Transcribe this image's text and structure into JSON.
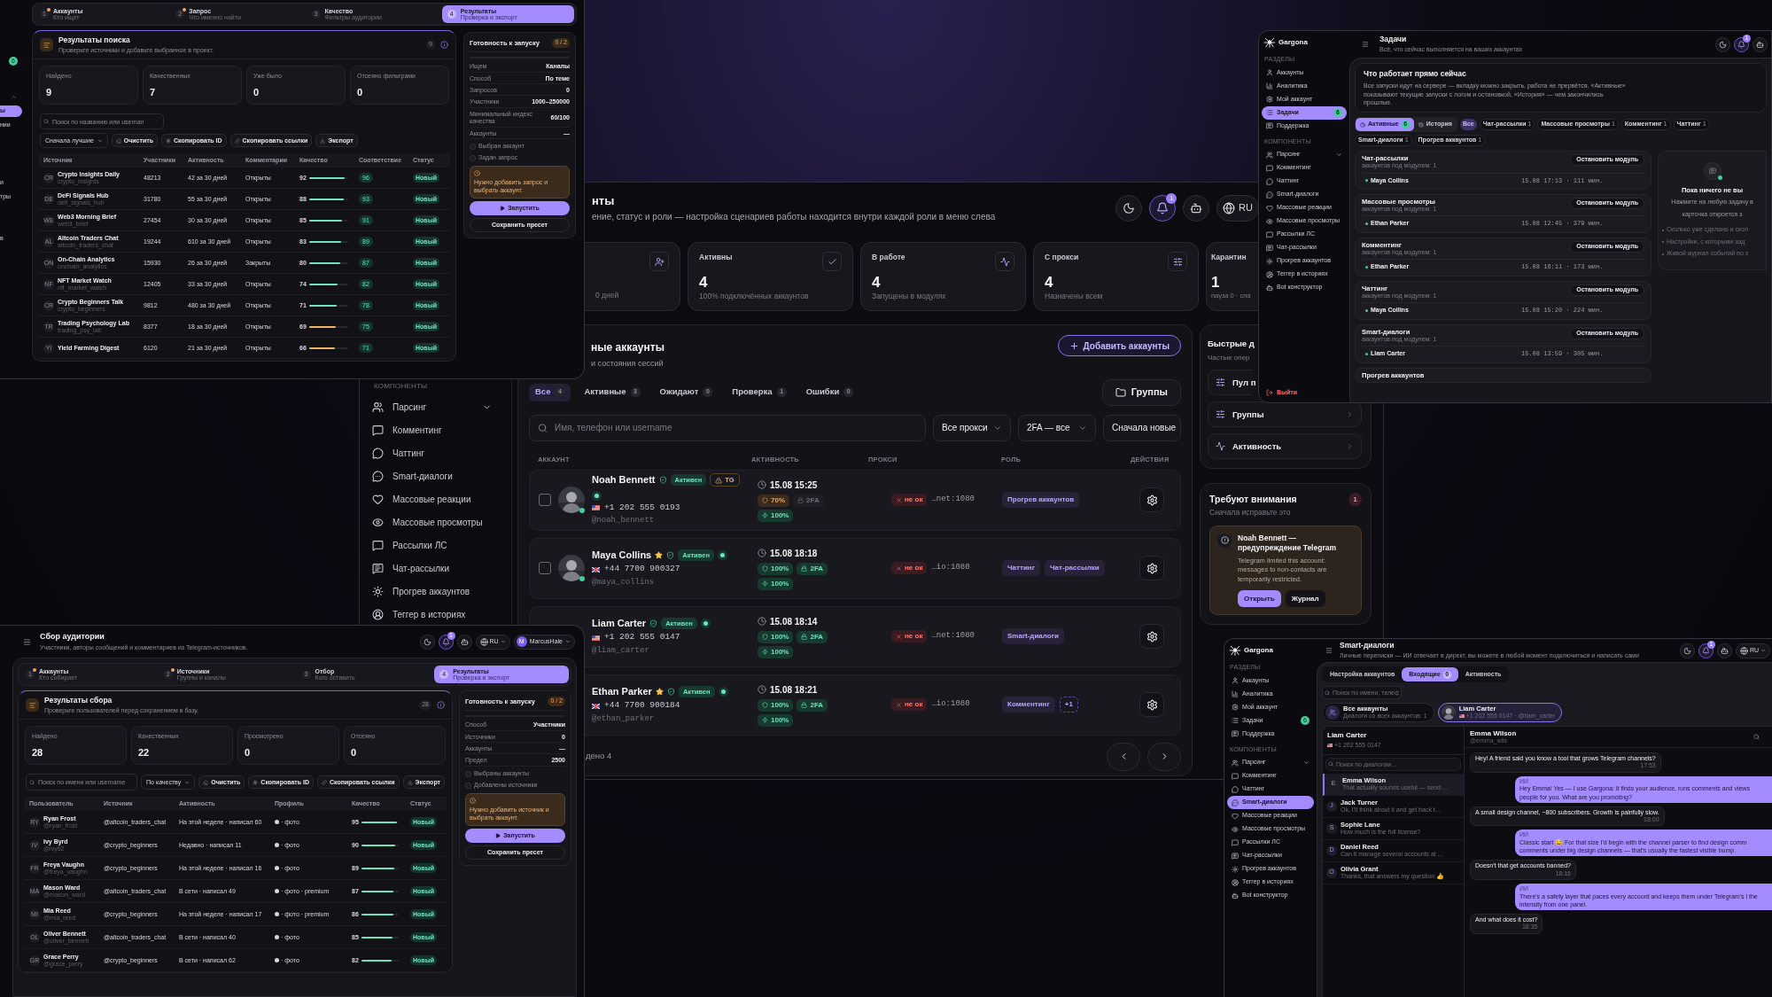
{
  "accounts_window": {
    "sidebar": {
      "sections": [
        {
          "title": "КОМПОНЕНТЫ",
          "items": [
            {
              "label": "Парсинг",
              "selected": false,
              "expanded": false
            },
            {
              "label": "Комментинг",
              "selected": false
            },
            {
              "label": "Чаттинг",
              "selected": false
            },
            {
              "label": "Smart-диалоги",
              "selected": false
            },
            {
              "label": "Массовые реакции",
              "selected": false
            },
            {
              "label": "Массовые просмотры",
              "selected": false
            },
            {
              "label": "Рассылки ЛС",
              "selected": false
            },
            {
              "label": "Чат-рассылки",
              "selected": false
            },
            {
              "label": "Прогрев аккаунтов",
              "selected": false
            },
            {
              "label": "Теггер в историях",
              "selected": false
            }
          ]
        }
      ]
    },
    "header": {
      "title": "нты",
      "subtitle": "ение, статус и роли — настройка сценариев работы находится внутри каждой роли в меню слева",
      "notifications": "1",
      "language": "RU"
    },
    "stats": [
      {
        "note": "0 дней"
      },
      {
        "label": "Активны",
        "value": "4",
        "note": "100% подключённых аккаунтов"
      },
      {
        "label": "В работе",
        "value": "4",
        "note": "Запущены в модулях"
      },
      {
        "label": "С прокси",
        "value": "4",
        "note": "Назначены всем"
      },
      {
        "label": "Карантин",
        "value": "1",
        "note": "пауза 0 · спа"
      }
    ],
    "panel": {
      "title": "ные аккаунты",
      "subtitle": "и состояния сессий",
      "add_button": "Добавить аккаунты",
      "groups_button": "Группы",
      "tabs": [
        {
          "label": "Все",
          "count": "4",
          "selected": true
        },
        {
          "label": "Активные",
          "count": "3",
          "selected": false
        },
        {
          "label": "Ожидают",
          "count": "0",
          "selected": false
        },
        {
          "label": "Проверка",
          "count": "1",
          "selected": false
        },
        {
          "label": "Ошибки",
          "count": "0",
          "selected": false
        }
      ],
      "search": {
        "placeholder": "Имя, телефон или username"
      },
      "filters": [
        "Все прокси",
        "2FA — все",
        "Сначала новые"
      ],
      "columns": [
        "АККАУНТ",
        "АКТИВНОСТЬ",
        "ПРОКСИ",
        "РОЛЬ",
        "ДЕЙСТВИЯ"
      ],
      "rows": [
        {
          "selected": false,
          "avatar": {
            "kind": "picture",
            "online": true
          },
          "name": "Noah Bennett",
          "starred": false,
          "status": "Активен",
          "warning": "TG",
          "flag": {
            "kind": "us"
          },
          "phone": "+1 202 555 0193",
          "username": "@noah_bennett",
          "last_active": "15.08 15:25",
          "trust": "70%",
          "trust_ok": false,
          "twofa": "2FA",
          "twofa_on": false,
          "energy": "100%",
          "proxy_status": "не ок",
          "proxy": "…net:1080",
          "roles": [
            {
              "label": "Прогрев аккаунтов",
              "kind": "role"
            }
          ]
        },
        {
          "selected": false,
          "avatar": {
            "kind": "picture",
            "online": true
          },
          "name": "Maya Collins",
          "starred": true,
          "status": "Активен",
          "flag": {
            "kind": "gb"
          },
          "phone": "+44 7700 900327",
          "username": "@maya_collins",
          "last_active": "15.08 18:18",
          "trust": "100%",
          "trust_ok": true,
          "twofa": "2FA",
          "twofa_on": true,
          "energy": "100%",
          "proxy_status": "не ок",
          "proxy": "…io:1080",
          "roles": [
            {
              "label": "Чаттинг",
              "kind": "role"
            },
            {
              "label": "Чат-рассылки",
              "kind": "role"
            }
          ]
        },
        {
          "name": "Liam Carter",
          "starred": false,
          "status": "Активен",
          "flag": {
            "kind": "us"
          },
          "phone": "+1 202 555 0147",
          "username": "@liam_carter",
          "last_active": "15.08 18:14",
          "trust": "100%",
          "trust_ok": true,
          "twofa": "2FA",
          "twofa_on": true,
          "energy": "100%",
          "proxy_status": "не ок",
          "proxy": "…net:1080",
          "roles": [
            {
              "label": "Smart-диалоги",
              "kind": "role"
            }
          ]
        },
        {
          "name": "Ethan Parker",
          "starred": true,
          "status": "Активен",
          "flag": {
            "kind": "gb"
          },
          "phone": "+44 7700 900184",
          "username": "@ethan_parker",
          "last_active": "15.08 18:21",
          "trust": "100%",
          "trust_ok": true,
          "twofa": "2FA",
          "twofa_on": true,
          "energy": "100%",
          "proxy_status": "не ок",
          "proxy": "…io:1080",
          "roles": [
            {
              "label": "Комментинг",
              "kind": "role"
            },
            {
              "label": "+1",
              "kind": "more"
            }
          ]
        }
      ],
      "footer": "дено 4"
    },
    "quick": {
      "title": "Быстрые д",
      "subtitle": "Частые опер",
      "items": [
        {
          "label": "Пул п",
          "chevron": false
        },
        {
          "label": "Группы",
          "chevron": true
        },
        {
          "label": "Активность",
          "chevron": true
        }
      ]
    },
    "attention": {
      "title": "Требуют внимания",
      "subtitle": "Сначала исправьте это",
      "count": "1",
      "alert": {
        "title": "Noah Bennett — предупреждение Telegram",
        "text": "Telegram limited this account: messages to non-contacts are temporarily restricted.",
        "buttons": [
          "Открыть",
          "Журнал"
        ]
      }
    }
  },
  "search_window": {
    "sidebar": {
      "badge": "6",
      "items": [
        {
          "label": "ы",
          "selected": true
        },
        {
          "label": "нии",
          "selected": false
        },
        {
          "label": "и",
          "selected": false
        },
        {
          "label": "тры",
          "selected": false
        },
        {
          "label": "в",
          "selected": false
        }
      ]
    },
    "steps": [
      {
        "number": "1",
        "title": "Аккаунты",
        "subtitle": "Кто ищет",
        "pending": true,
        "selected": false
      },
      {
        "number": "2",
        "title": "Запрос",
        "subtitle": "Что именно найти",
        "pending": true,
        "selected": false
      },
      {
        "number": "3",
        "title": "Качество",
        "subtitle": "Фильтры аудитории",
        "pending": false,
        "selected": false
      },
      {
        "number": "4",
        "title": "Результаты",
        "subtitle": "Проверка и экспорт",
        "pending": false,
        "selected": true
      }
    ],
    "results": {
      "title": "Результаты поиска",
      "subtitle": "Проверьте источники и добавьте выбранное в проект.",
      "count": "9",
      "stats": [
        {
          "label": "Найдено",
          "value": "9"
        },
        {
          "label": "Качественных",
          "value": "7"
        },
        {
          "label": "Уже было",
          "value": "0"
        },
        {
          "label": "Отсеяно фильтрами",
          "value": "0"
        }
      ],
      "search": {
        "placeholder": "Поиск по названию или usernan"
      },
      "sort": "Сначала лучшие",
      "actions": [
        "Очистить",
        "Скопировать ID",
        "Скопировать ссылки",
        "Экспорт"
      ],
      "columns": [
        "Источник",
        "Участники",
        "Активность",
        "Комментарии",
        "Качество",
        "Соответствие",
        "Статус"
      ],
      "rows": [
        {
          "initials": "CR",
          "name": "Crypto Insights Daily",
          "handle": "crypto_insights",
          "members": "48213",
          "activity": "42 за 30 дней",
          "comments": "Открыты",
          "quality": "92",
          "level": 0.92,
          "color": "#6be3c4",
          "match": "96",
          "status": "Новый"
        },
        {
          "initials": "DE",
          "name": "DeFi Signals Hub",
          "handle": "defi_signals_hub",
          "members": "31780",
          "activity": "55 за 30 дней",
          "comments": "Открыты",
          "quality": "88",
          "level": 0.88,
          "color": "#6be3c4",
          "match": "93",
          "status": "Новый"
        },
        {
          "initials": "WE",
          "name": "Web3 Morning Brief",
          "handle": "web3_brief",
          "members": "27454",
          "activity": "30 за 30 дней",
          "comments": "Открыты",
          "quality": "85",
          "level": 0.85,
          "color": "#6be3c4",
          "match": "91",
          "status": "Новый"
        },
        {
          "initials": "AL",
          "name": "Altcoin Traders Chat",
          "handle": "altcoin_traders_chat",
          "members": "19244",
          "activity": "610 за 30 дней",
          "comments": "Открыты",
          "quality": "83",
          "level": 0.83,
          "color": "#6be3c4",
          "match": "89",
          "status": "Новый"
        },
        {
          "initials": "ON",
          "name": "On-Chain Analytics",
          "handle": "onchain_analytics",
          "members": "15930",
          "activity": "26 за 30 дней",
          "comments": "Закрыты",
          "quality": "80",
          "level": 0.8,
          "color": "#6be3c4",
          "match": "87",
          "status": "Новый"
        },
        {
          "initials": "NF",
          "name": "NFT Market Watch",
          "handle": "nft_market_watch",
          "members": "12405",
          "activity": "33 за 30 дней",
          "comments": "Открыты",
          "quality": "74",
          "level": 0.74,
          "color": "#6be3c4",
          "match": "82",
          "status": "Новый"
        },
        {
          "initials": "CR",
          "name": "Crypto Beginners Talk",
          "handle": "crypto_beginners",
          "members": "9812",
          "activity": "480 за 30 дней",
          "comments": "Открыты",
          "quality": "71",
          "level": 0.71,
          "color": "#6be3c4",
          "match": "78",
          "status": "Новый"
        },
        {
          "initials": "TR",
          "name": "Trading Psychology Lab",
          "handle": "trading_psy_lab",
          "members": "8377",
          "activity": "18 за 30 дней",
          "comments": "Открыты",
          "quality": "69",
          "level": 0.69,
          "color": "#f2b264",
          "match": "75",
          "status": "Новый"
        },
        {
          "initials": "YI",
          "name": "Yield Farming Digest",
          "members": "6120",
          "activity": "21 за 30 дней",
          "comments": "Открыты",
          "quality": "66",
          "level": 0.66,
          "color": "#f2b264",
          "match": "71",
          "status": "Новый"
        }
      ]
    },
    "readiness": {
      "title": "Готовность к запуску",
      "badge": "0 / 2",
      "rows": [
        {
          "label": "Ищем",
          "value": "Каналы"
        },
        {
          "label": "Способ",
          "value": "По теме"
        },
        {
          "label": "Запросов",
          "value": "0"
        },
        {
          "label": "Участники",
          "value": "1000–250000"
        },
        {
          "label": "Минимальный индекс качества",
          "value": "60/100"
        },
        {
          "label": "Аккаунты",
          "value": "—"
        }
      ],
      "checks": [
        {
          "label": "Выбран аккаунт",
          "checked": false
        },
        {
          "label": "Задан запрос",
          "checked": false
        }
      ],
      "warning": "Нужно добавить запрос и выбрать аккаунт.",
      "run": "Запустить",
      "save": "Сохранить пресет"
    }
  },
  "audience_window": {
    "header": {
      "title": "Сбор аудитории",
      "subtitle": "Участники, авторы сообщений и комментариев из Telegram-источников.",
      "notifications": "1",
      "language": "RU",
      "user_initial": "M",
      "user": "MarcusHale"
    },
    "steps": [
      {
        "number": "1",
        "title": "Аккаунты",
        "subtitle": "Кто собирает",
        "pending": true,
        "selected": false
      },
      {
        "number": "2",
        "title": "Источники",
        "subtitle": "Группы и каналы",
        "pending": true,
        "selected": false
      },
      {
        "number": "3",
        "title": "Отбор",
        "subtitle": "Кого оставить",
        "pending": false,
        "selected": false
      },
      {
        "number": "4",
        "title": "Результаты",
        "subtitle": "Проверка и экспорт",
        "pending": false,
        "selected": true
      }
    ],
    "results": {
      "title": "Результаты сбора",
      "subtitle": "Проверьте пользователей перед сохранением в базу.",
      "count": "28",
      "stats": [
        {
          "label": "Найдено",
          "value": "28"
        },
        {
          "label": "Качественных",
          "value": "22"
        },
        {
          "label": "Просмотрено",
          "value": "0"
        },
        {
          "label": "Отсеяно",
          "value": "0"
        }
      ],
      "search": {
        "placeholder": "Поиск по имени или username"
      },
      "sort": "По качеству",
      "actions": [
        "Очистить",
        "Скопировать ID",
        "Скопировать ссылки",
        "Экспорт"
      ],
      "columns": [
        "Пользователь",
        "Источник",
        "Активность",
        "Профиль",
        "Качество",
        "Статус"
      ],
      "rows": [
        {
          "initials": "RY",
          "name": "Ryan Frost",
          "handle": "@ryan_frost",
          "source": "@altcoin_traders_chat",
          "activity": "На этой неделе · написал 60",
          "profile": "· фото",
          "quality": "95",
          "level": 0.95,
          "status": "Новый"
        },
        {
          "initials": "IV",
          "name": "Ivy Byrd",
          "handle": "@ivy62",
          "source": "@crypto_beginners",
          "activity": "Недавно · написал 11",
          "profile": "· фото",
          "quality": "90",
          "level": 0.9,
          "status": "Новый"
        },
        {
          "initials": "FR",
          "name": "Freya Vaughn",
          "handle": "@freya_vaughn",
          "source": "@crypto_beginners",
          "activity": "На этой неделе · написал 16",
          "profile": "· фото",
          "quality": "89",
          "level": 0.89,
          "status": "Новый"
        },
        {
          "initials": "MA",
          "name": "Mason Ward",
          "handle": "@mason_ward",
          "source": "@altcoin_traders_chat",
          "activity": "В сети · написал 49",
          "profile": "· фото · premium",
          "quality": "87",
          "level": 0.87,
          "status": "Новый"
        },
        {
          "initials": "MI",
          "name": "Mia Reed",
          "handle": "@mia_reed",
          "source": "@crypto_beginners",
          "activity": "На этой неделе · написал 17",
          "profile": "· фото · premium",
          "quality": "86",
          "level": 0.86,
          "status": "Новый"
        },
        {
          "initials": "OL",
          "name": "Oliver Bennett",
          "handle": "@oliver_bennett",
          "source": "@altcoin_traders_chat",
          "activity": "В сети · написал 40",
          "profile": "· фото",
          "quality": "85",
          "level": 0.85,
          "status": "Новый"
        },
        {
          "initials": "GR",
          "name": "Grace Perry",
          "handle": "@grace_perry",
          "source": "@crypto_beginners",
          "activity": "В сети · написал 62",
          "profile": "· фото",
          "quality": "82",
          "level": 0.82,
          "status": "Новый"
        }
      ]
    },
    "readiness": {
      "title": "Готовность к запуску",
      "badge": "0 / 2",
      "rows": [
        {
          "label": "Способ",
          "value": "Участники"
        },
        {
          "label": "Источники",
          "value": "0"
        },
        {
          "label": "Аккаунты",
          "value": "—"
        },
        {
          "label": "Предел",
          "value": "2500"
        }
      ],
      "checks": [
        {
          "label": "Выбраны аккаунты",
          "checked": false
        },
        {
          "label": "Добавлены источники",
          "checked": false
        }
      ],
      "warning": "Нужно добавить источник и выбрать аккаунт.",
      "run": "Запустить",
      "save": "Сохранить пресет"
    }
  },
  "tasks_window": {
    "brand": "Gargona",
    "sections": [
      {
        "title": "РАЗДЕЛЫ",
        "items": [
          {
            "label": "Аккаунты",
            "selected": false
          },
          {
            "label": "Аналитика",
            "selected": false
          },
          {
            "label": "Мой аккаунт",
            "selected": false
          },
          {
            "label": "Задачи",
            "selected": true,
            "badge": "6"
          },
          {
            "label": "Поддержка",
            "selected": false
          }
        ]
      },
      {
        "title": "КОМПОНЕНТЫ",
        "items": [
          {
            "label": "Парсинг",
            "selected": false,
            "expanded": false
          },
          {
            "label": "Комментинг",
            "selected": false
          },
          {
            "label": "Чаттинг",
            "selected": false
          },
          {
            "label": "Smart-диалоги",
            "selected": false
          },
          {
            "label": "Массовые реакции",
            "selected": false
          },
          {
            "label": "Массовые просмотры",
            "selected": false
          },
          {
            "label": "Рассылки ЛС",
            "selected": false
          },
          {
            "label": "Чат-рассылки",
            "selected": false
          },
          {
            "label": "Прогрев аккаунтов",
            "selected": false
          },
          {
            "label": "Теггер в историях",
            "selected": false
          },
          {
            "label": "Bot конструктор",
            "selected": false
          }
        ]
      }
    ],
    "logout": "Выйти",
    "header": {
      "title": "Задачи",
      "subtitle": "Всё, что сейчас выполняется на ваших аккаунтах",
      "notifications": "1"
    },
    "intro": {
      "title": "Что работает прямо сейчас",
      "text": "Все запуски идут на сервере — вкладку можно закрыть, работа не прервётся. «Активные» показывают текущие запуски с логом и остановкой, «История» — чем закончились прошлые."
    },
    "tabs": [
      {
        "label": "Активные",
        "count": "6",
        "selected": true
      },
      {
        "label": "История",
        "selected": false
      }
    ],
    "filters": [
      {
        "label": "Все",
        "selected": true
      },
      {
        "label": "Чат-рассылки",
        "count": "1",
        "selected": false
      },
      {
        "label": "Массовые просмотры",
        "count": "1",
        "selected": false
      },
      {
        "label": "Комментинг",
        "count": "1",
        "selected": false
      },
      {
        "label": "Чаттинг",
        "count": "1",
        "selected": false
      },
      {
        "label": "Smart-диалоги",
        "count": "1",
        "selected": false
      },
      {
        "label": "Прогрев аккаунтов",
        "count": "1",
        "selected": false
      }
    ],
    "tasks": [
      {
        "title": "Чат-рассылки",
        "subtitle": "аккаунтов под модулем: 1",
        "account": "Maya Collins",
        "time": "15.08 17:13 · 111 мин.",
        "button": "Остановить модуль"
      },
      {
        "title": "Массовые просмотры",
        "subtitle": "аккаунтов под модулем: 1",
        "account": "Ethan Parker",
        "time": "15.08 12:45 · 379 мин.",
        "button": "Остановить модуль"
      },
      {
        "title": "Комментинг",
        "subtitle": "аккаунтов под модулем: 1",
        "account": "Ethan Parker",
        "time": "15.08 16:11 · 173 мин.",
        "button": "Остановить модуль"
      },
      {
        "title": "Чаттинг",
        "subtitle": "аккаунтов под модулем: 1",
        "account": "Maya Collins",
        "time": "15.08 15:20 · 224 мин.",
        "button": "Остановить модуль"
      },
      {
        "title": "Smart-диалоги",
        "subtitle": "аккаунтов под модулем: 1",
        "account": "Liam Carter",
        "time": "15.08 13:59 · 305 мин.",
        "button": "Остановить модуль"
      },
      {
        "title": "Прогрев аккаунтов"
      }
    ],
    "empty": {
      "title": "Пока ничего не вы",
      "lines": [
        "Нажмите на любую задачу в",
        "карточка откроется з"
      ],
      "bullets": [
        "Сколько уже сделано и скол",
        "Настройки, с которыми зад",
        "Живой журнал событий по з"
      ]
    }
  },
  "dialogs_window": {
    "brand": "Gargona",
    "sections": [
      {
        "title": "РАЗДЕЛЫ",
        "items": [
          {
            "label": "Аккаунты",
            "selected": false
          },
          {
            "label": "Аналитика",
            "selected": false
          },
          {
            "label": "Мой аккаунт",
            "selected": false
          },
          {
            "label": "Задачи",
            "selected": false,
            "badge": "6"
          },
          {
            "label": "Поддержка",
            "selected": false
          }
        ]
      },
      {
        "title": "КОМПОНЕНТЫ",
        "items": [
          {
            "label": "Парсинг",
            "selected": false,
            "expanded": false
          },
          {
            "label": "Комментинг",
            "selected": false
          },
          {
            "label": "Чаттинг",
            "selected": false
          },
          {
            "label": "Smart-диалоги",
            "selected": true
          },
          {
            "label": "Массовые реакции",
            "selected": false
          },
          {
            "label": "Массовые просмотры",
            "selected": false
          },
          {
            "label": "Рассылки ЛС",
            "selected": false
          },
          {
            "label": "Чат-рассылки",
            "selected": false
          },
          {
            "label": "Прогрев аккаунтов",
            "selected": false
          },
          {
            "label": "Теггер в историях",
            "selected": false
          },
          {
            "label": "Bot конструктор",
            "selected": false
          }
        ]
      }
    ],
    "header": {
      "title": "Smart-диалоги",
      "subtitle": "Личные переписки — ИИ отвечает в директ, вы можете в любой момент подключиться и написать сами",
      "notifications": "1",
      "language": "RU"
    },
    "tabs": [
      {
        "label": "Настройка аккаунтов",
        "selected": false
      },
      {
        "label": "Входящие",
        "count": "0",
        "selected": true
      },
      {
        "label": "Активность",
        "selected": false
      }
    ],
    "search": {
      "placeholder": "Поиск по имени, телеф"
    },
    "accounts": [
      {
        "kind": "all",
        "title": "Все аккаунты",
        "subtitle": "Диалоги со всех аккаунтов: 1",
        "selected": false
      },
      {
        "kind": "account",
        "title": "Liam Carter",
        "flag": {
          "kind": "us"
        },
        "subtitle": "+1 202 555 0147 · @liam_carter",
        "selected": true
      }
    ],
    "dialogs": {
      "account": "Liam Carter",
      "flag": {
        "kind": "us"
      },
      "phone": "+1 202 555 0147",
      "search": {
        "placeholder": "Поиск по диалогам..."
      },
      "items": [
        {
          "initial": "E",
          "name": "Emma Wilson",
          "preview": "That actually sounds useful — send ...",
          "selected": true
        },
        {
          "initial": "J",
          "name": "Jack Turner",
          "preview": "Ok, I'll think about it and get back t...",
          "selected": false
        },
        {
          "initial": "S",
          "name": "Sophie Lane",
          "preview": "How much is the full license?",
          "selected": false
        },
        {
          "initial": "D",
          "name": "Daniel Reed",
          "preview": "Can it manage several accounts at ...",
          "selected": false
        },
        {
          "initial": "O",
          "name": "Olivia Grant",
          "preview": "Thanks, that answers my question 👍",
          "selected": false
        }
      ]
    },
    "chat": {
      "name": "Emma Wilson",
      "handle": "@emma_wils",
      "messages": [
        {
          "kind": "in",
          "text": "Hey! A friend said you know a tool that grows Telegram channels?",
          "time": "17:53"
        },
        {
          "kind": "out",
          "label": "ИИ",
          "text": "Hey Emma! Yes — I use Gargona: it finds your audience, runs comments and views people for you. What are you promoting?"
        },
        {
          "kind": "in",
          "text": "A small design channel, ~800 subscribers. Growth is painfully slow.",
          "time": "18:00"
        },
        {
          "kind": "out",
          "label": "ИИ",
          "text": "Classic start 😅 For that size I'd begin with the channel parser to find design comm comments under big design channels — that's usually the fastest visible bump."
        },
        {
          "kind": "in",
          "text": "Doesn't that get accounts banned?",
          "time": "18:16"
        },
        {
          "kind": "out",
          "label": "ИИ",
          "text": "There's a safety layer that paces every account and keeps them under Telegram's l the intensity from one panel."
        },
        {
          "kind": "in",
          "text": "And what does it cost?",
          "time": "18:35"
        }
      ]
    }
  }
}
